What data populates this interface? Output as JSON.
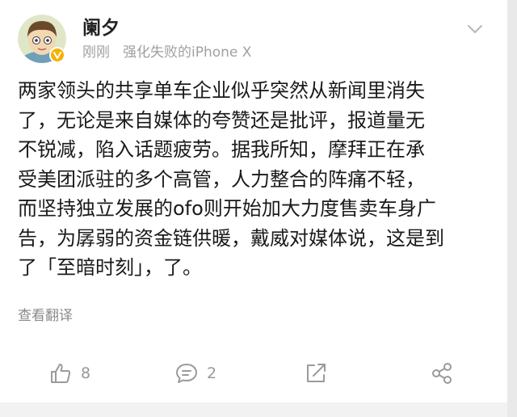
{
  "post": {
    "author": "阑夕",
    "timestamp": "刚刚",
    "source": "强化失败的iPhone X",
    "lines": [
      "两家领头的共享单车企业似乎突然从新闻里消失",
      "了，无论是来自媒体的夸赞还是批评，报道量无",
      "不锐减，陷入话题疲劳。据我所知，摩拜正在承",
      "受美团派驻的多个高管，人力整合的阵痛不轻，",
      "而坚持独立发展的ofo则开始加大力度售卖车身广",
      "告，为孱弱的资金链供暖，戴威对媒体说，这是到",
      "了「至暗时刻」，了。"
    ],
    "translate_label": "查看翻译"
  },
  "actions": {
    "like_count": "8",
    "comment_count": "2"
  },
  "icons": {
    "avatar": "avatar-cartoon-boy",
    "verified": "verified-badge-icon",
    "menu": "chevron-down-icon",
    "like": "thumbs-up-icon",
    "comment": "comment-icon",
    "repost": "repost-icon",
    "share": "share-icon"
  },
  "colors": {
    "verified_badge": "#f6b100",
    "meta_text": "#a0a0a0",
    "icon_gray": "#9a9a9a"
  }
}
